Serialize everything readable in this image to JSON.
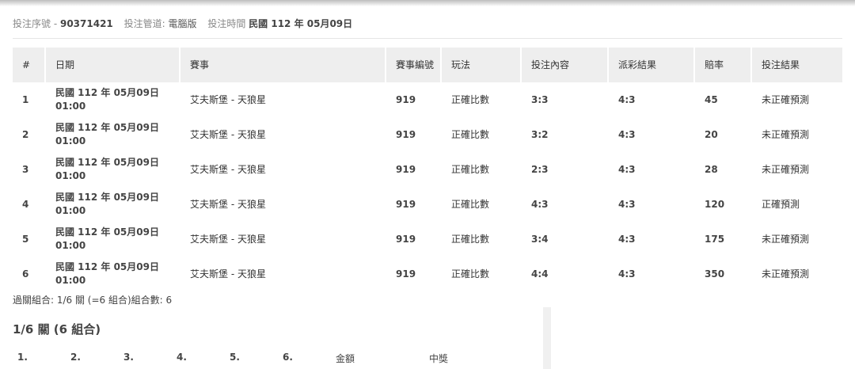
{
  "header": {
    "serial_label": "投注序號 -",
    "serial_value": "90371421",
    "channel_label": "投注管道:",
    "channel_value": "電腦版",
    "time_label": "投注時間",
    "time_value": "民國 112 年 05月09日"
  },
  "table": {
    "columns": [
      "#",
      "日期",
      "賽事",
      "賽事編號",
      "玩法",
      "投注內容",
      "派彩結果",
      "賠率",
      "投注結果"
    ],
    "rows": [
      {
        "num": "1",
        "date": "民國 112 年 05月09日",
        "time": "01:00",
        "match": "艾夫斯堡 - 天狼星",
        "match_no": "919",
        "play": "正確比數",
        "bet": "3:3",
        "payout": "4:3",
        "odds": "45",
        "result": "未正確預測"
      },
      {
        "num": "2",
        "date": "民國 112 年 05月09日",
        "time": "01:00",
        "match": "艾夫斯堡 - 天狼星",
        "match_no": "919",
        "play": "正確比數",
        "bet": "3:2",
        "payout": "4:3",
        "odds": "20",
        "result": "未正確預測"
      },
      {
        "num": "3",
        "date": "民國 112 年 05月09日",
        "time": "01:00",
        "match": "艾夫斯堡 - 天狼星",
        "match_no": "919",
        "play": "正確比數",
        "bet": "2:3",
        "payout": "4:3",
        "odds": "28",
        "result": "未正確預測"
      },
      {
        "num": "4",
        "date": "民國 112 年 05月09日",
        "time": "01:00",
        "match": "艾夫斯堡 - 天狼星",
        "match_no": "919",
        "play": "正確比數",
        "bet": "4:3",
        "payout": "4:3",
        "odds": "120",
        "result": "正確預測"
      },
      {
        "num": "5",
        "date": "民國 112 年 05月09日",
        "time": "01:00",
        "match": "艾夫斯堡 - 天狼星",
        "match_no": "919",
        "play": "正確比數",
        "bet": "3:4",
        "payout": "4:3",
        "odds": "175",
        "result": "未正確預測"
      },
      {
        "num": "6",
        "date": "民國 112 年 05月09日",
        "time": "01:00",
        "match": "艾夫斯堡 - 天狼星",
        "match_no": "919",
        "play": "正確比數",
        "bet": "4:4",
        "payout": "4:3",
        "odds": "350",
        "result": "未正確預測"
      }
    ]
  },
  "summary": "過關組合: 1/6 關 (=6 組合)組合數: 6",
  "section_title": "1/6 關 (6 組合)",
  "combo_headers": [
    "1.",
    "2.",
    "3.",
    "4.",
    "5.",
    "6.",
    "金額",
    "中獎"
  ]
}
